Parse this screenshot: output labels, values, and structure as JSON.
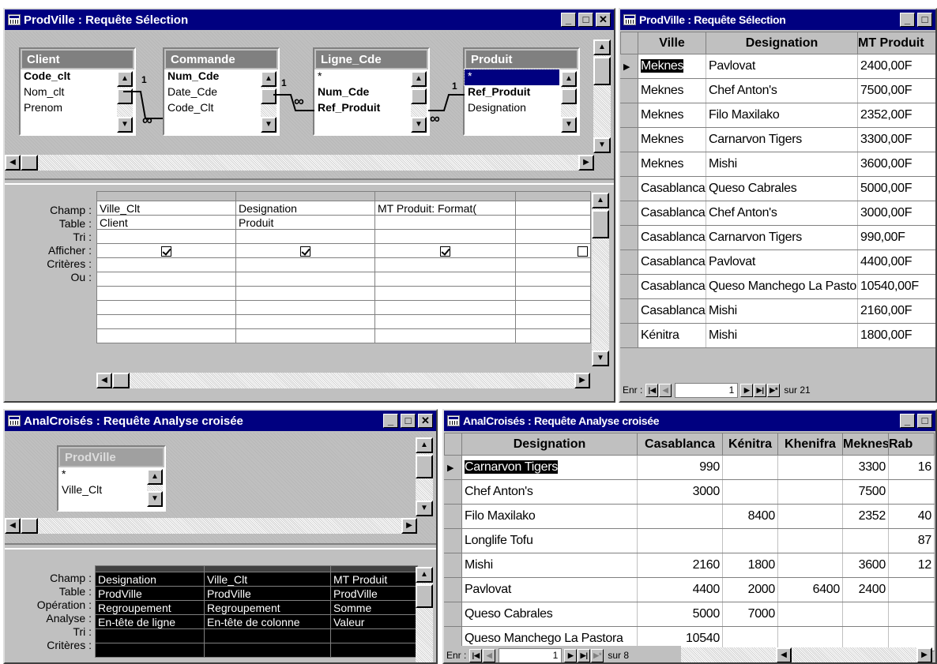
{
  "w1": {
    "title": "ProdVille : Requête Sélection",
    "tables": [
      {
        "name": "Client",
        "fields": [
          "Code_clt",
          "Nom_clt",
          "Prenom"
        ]
      },
      {
        "name": "Commande",
        "fields": [
          "Num_Cde",
          "Date_Cde",
          "Code_Clt"
        ]
      },
      {
        "name": "Ligne_Cde",
        "fields": [
          "*",
          "Num_Cde",
          "Ref_Produit"
        ]
      },
      {
        "name": "Produit",
        "fields": [
          "*",
          "Ref_Produit",
          "Designation"
        ]
      }
    ],
    "rel_one": "1",
    "rel_many": "∞",
    "labels": [
      "Champ :",
      "Table :",
      "Tri :",
      "Afficher :",
      "Critères :",
      "Ou :"
    ],
    "cols": [
      {
        "champ": "Ville_Clt",
        "table": "Client"
      },
      {
        "champ": "Designation",
        "table": "Produit"
      },
      {
        "champ": "MT Produit: Format(",
        "table": ""
      }
    ]
  },
  "w2": {
    "title": "ProdVille : Requête Sélection",
    "headers": [
      "Ville",
      "Designation",
      "MT Produit"
    ],
    "rows": [
      [
        "Meknes",
        "Pavlovat",
        "2400,00F"
      ],
      [
        "Meknes",
        "Chef Anton's",
        "7500,00F"
      ],
      [
        "Meknes",
        "Filo Maxilako",
        "2352,00F"
      ],
      [
        "Meknes",
        "Carnarvon Tigers",
        "3300,00F"
      ],
      [
        "Meknes",
        "Mishi",
        "3600,00F"
      ],
      [
        "Casablanca",
        "Queso Cabrales",
        "5000,00F"
      ],
      [
        "Casablanca",
        "Chef Anton's",
        "3000,00F"
      ],
      [
        "Casablanca",
        "Carnarvon Tigers",
        "990,00F"
      ],
      [
        "Casablanca",
        "Pavlovat",
        "4400,00F"
      ],
      [
        "Casablanca",
        "Queso Manchego La Pastora",
        "10540,00F"
      ],
      [
        "Casablanca",
        "Mishi",
        "2160,00F"
      ],
      [
        "Kénitra",
        "Mishi",
        "1800,00F"
      ]
    ],
    "nav": {
      "label": "Enr :",
      "record": "1",
      "total": "sur 21"
    }
  },
  "w3": {
    "title": "AnalCroisés : Requête Analyse croisée",
    "table": {
      "name": "ProdVille",
      "fields": [
        "*",
        "Ville_Clt"
      ]
    },
    "labels": [
      "Champ :",
      "Table :",
      "Opération :",
      "Analyse :",
      "Tri :",
      "Critères :"
    ],
    "cols": [
      [
        "Designation",
        "ProdVille",
        "Regroupement",
        "En-tête de ligne"
      ],
      [
        "Ville_Clt",
        "ProdVille",
        "Regroupement",
        "En-tête de colonne"
      ],
      [
        "MT Produit",
        "ProdVille",
        "Somme",
        "Valeur"
      ]
    ]
  },
  "w4": {
    "title": "AnalCroisés : Requête Analyse croisée",
    "headers": [
      "Designation",
      "Casablanca",
      "Kénitra",
      "Khenifra",
      "Meknes",
      "Rab"
    ],
    "rows": [
      [
        "Carnarvon Tigers",
        "990",
        "",
        "",
        "3300",
        "16"
      ],
      [
        "Chef Anton's",
        "3000",
        "",
        "",
        "7500",
        ""
      ],
      [
        "Filo Maxilako",
        "",
        "8400",
        "",
        "2352",
        "40"
      ],
      [
        "Longlife Tofu",
        "",
        "",
        "",
        "",
        "87"
      ],
      [
        "Mishi",
        "2160",
        "1800",
        "",
        "3600",
        "12"
      ],
      [
        "Pavlovat",
        "4400",
        "2000",
        "6400",
        "2400",
        ""
      ],
      [
        "Queso Cabrales",
        "5000",
        "7000",
        "",
        "",
        ""
      ],
      [
        "Queso Manchego La Pastora",
        "10540",
        "",
        "",
        "",
        ""
      ]
    ],
    "nav": {
      "label": "Enr :",
      "record": "1",
      "total": "sur 8"
    }
  }
}
